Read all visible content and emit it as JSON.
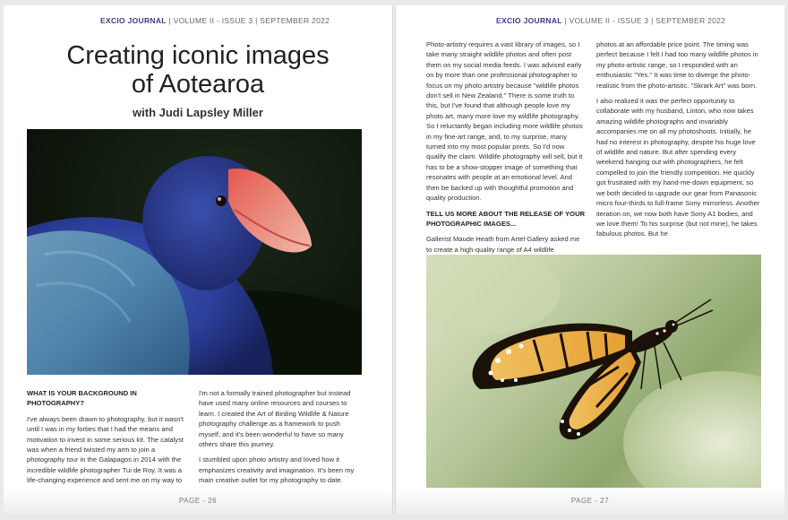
{
  "left_page": {
    "header_brand": "EXCIO JOURNAL",
    "header_rest": " | VOLUME II - ISSUE 3 | SEPTEMBER 2022",
    "title_line1": "Creating iconic images",
    "title_line2": "of Aotearoa",
    "byline": "with Judi Lapsley Miller",
    "q1": "WHAT IS YOUR BACKGROUND IN PHOTOGRAPHY?",
    "p1": "I've always been drawn to photography, but it wasn't until I was in my forties that I had the means and motivation to invest in some serious kit. The catalyst was when a friend twisted my arm to join a photography tour in the Galapagos in 2014 with the incredible wildlife photographer Tui de Roy. It was a life-changing experience and sent me on my way to advocate for our endangered species through art.",
    "p2": "I'm not a formally trained photographer but instead have used many online resources and courses to learn. I created the Art of Birding Wildlife & Nature photography challenge as a framework to push myself, and it's been wonderful to have so many others share this journey.",
    "p3": "I stumbled upon photo artistry and loved how it emphasizes creativity and imagination. It's been my main creative outlet for my photography to date.",
    "footer": "PAGE - 26"
  },
  "right_page": {
    "header_brand": "EXCIO JOURNAL",
    "header_rest": " | VOLUME II - ISSUE 3 | SEPTEMBER 2022",
    "p1": "Photo-artistry requires a vast library of images, so I take many straight wildlife photos and often post them on my social media feeds. I was advised early on by more than one professional photographer to focus on my photo artistry because \"wildlife photos don't sell in New Zealand.\" There is some truth to this, but I've found that although people love my photo art, many more love my wildlife photography. So I reluctantly began including more wildlife photos in my fine-art range, and, to my surprise, many turned into my most popular prints. So I'd now qualify the claim. Wildlife photography will sell, but it has to be a show-stopper image of something that resonates with people at an emotional level. And then be backed up with thoughtful promotion and quality production.",
    "q2": "TELL US MORE ABOUT THE RELEASE OF YOUR PHOTOGRAPHIC IMAGES...",
    "p2": "Gallerist Maude Heath from Artel Gallery asked me to create a high-quality range of A4 wildlife",
    "p3": "photos at an affordable price point. The timing was perfect because I felt I had too many wildlife photos in my photo-artistic range, so I responded with an enthusiastic \"Yes.\" It was time to diverge the photo-realistic from the photo-artistic. \"Skrark Art\" was born.",
    "p4": "I also realized it was the perfect opportunity to collaborate with my husband, Linton, who now takes amazing wildlife photographs and invariably accompanies me on all my photoshoots. Initially, he had no interest in photography, despite his huge love of wildlife and nature. But after spending every weekend hanging out with photographers, he felt compelled to join the friendly competition. He quickly got frustrated with my hand-me-down equipment, so we both decided to upgrade our gear from Panasonic micro four-thirds to full-frame Sony mirrorless. Another iteration on, we now both have Sony A1 bodies, and we love them! To his surprise (but not mine), he takes fabulous photos. But he",
    "footer": "PAGE - 27"
  },
  "colors": {
    "brand": "#3d3a8c",
    "bird_blue": "#2b3f9a",
    "beak_red": "#d8534a"
  }
}
